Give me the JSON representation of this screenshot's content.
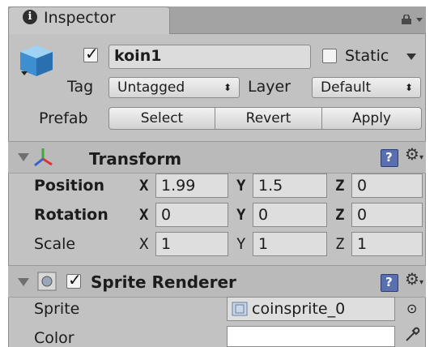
{
  "inspector": {
    "tab_title": "Inspector"
  },
  "gameobject": {
    "active": true,
    "name": "koin1",
    "static_label": "Static",
    "static_checked": false,
    "tag_label": "Tag",
    "tag_value": "Untagged",
    "layer_label": "Layer",
    "layer_value": "Default"
  },
  "prefab": {
    "label": "Prefab",
    "select_label": "Select",
    "revert_label": "Revert",
    "apply_label": "Apply"
  },
  "transform": {
    "title": "Transform",
    "position_label": "Position",
    "rotation_label": "Rotation",
    "scale_label": "Scale",
    "x_label": "X",
    "y_label": "Y",
    "z_label": "Z",
    "position": {
      "x": "1.99",
      "y": "1.5",
      "z": "0"
    },
    "rotation": {
      "x": "0",
      "y": "0",
      "z": "0"
    },
    "scale": {
      "x": "1",
      "y": "1",
      "z": "1"
    }
  },
  "sprite_renderer": {
    "title": "Sprite Renderer",
    "enabled": true,
    "sprite_label": "Sprite",
    "sprite_value": "coinsprite_0",
    "color_label": "Color",
    "color_value": "#ffffff"
  },
  "icons": {
    "info": "info-icon",
    "lock": "lock-icon",
    "cube": "gameobject-cube-icon",
    "transform": "transform-axes-icon",
    "help": "help-book-icon",
    "gear": "gear-icon",
    "picker": "object-picker-icon",
    "eyedropper": "eyedropper-icon"
  }
}
